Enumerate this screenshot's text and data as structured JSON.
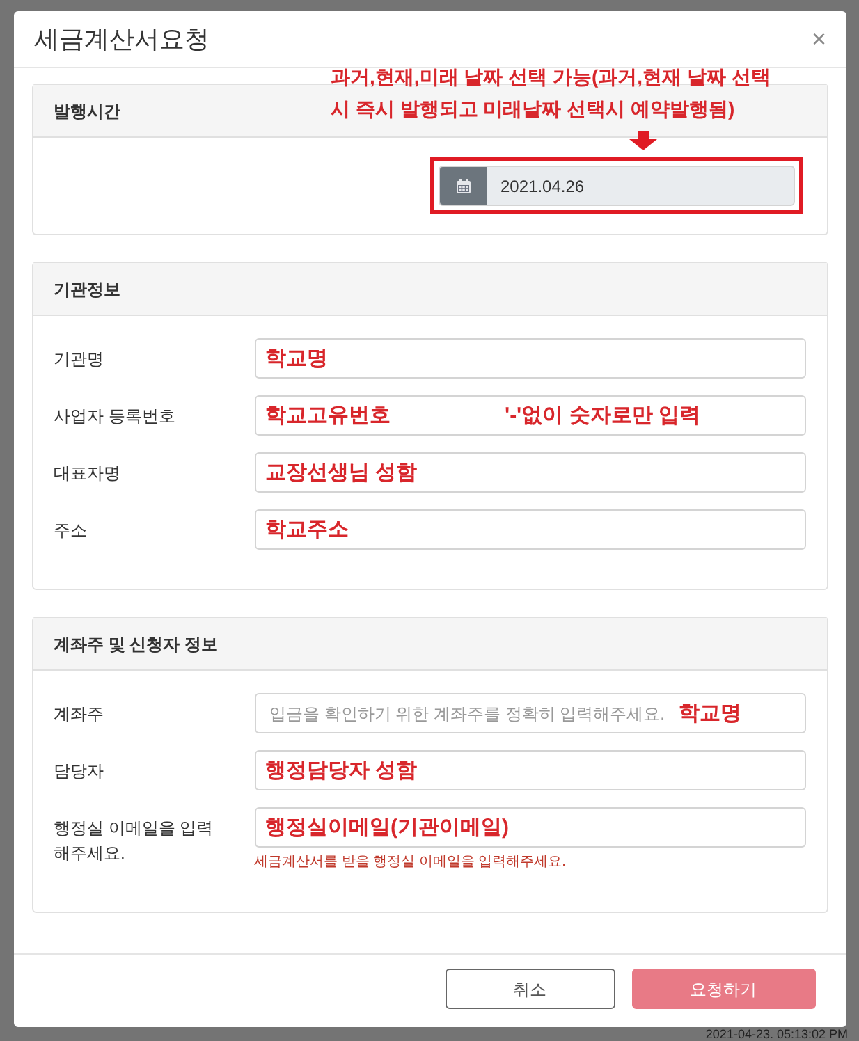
{
  "dialog": {
    "title": "세금계산서요청",
    "close": "×"
  },
  "annotation": {
    "lines": [
      "과거,현재,미래 날짜 선택 가능(과거,현재 날짜 선택",
      "시 즉시 발행되고 미래날짜 선택시 예약발행됨)"
    ]
  },
  "sections": [
    {
      "title": "발행시간",
      "kind": "date",
      "date": "2021.04.26"
    },
    {
      "title": "기관정보",
      "kind": "form",
      "fields": [
        {
          "label": "기관명",
          "annotation": "학교명"
        },
        {
          "label": "사업자 등록번호",
          "annotation": "학교고유번호",
          "note": "'-'없이 숫자로만 입력"
        },
        {
          "label": "대표자명",
          "annotation": "교장선생님 성함"
        },
        {
          "label": "주소",
          "annotation": "학교주소"
        }
      ]
    },
    {
      "title": "계좌주 및 신청자 정보",
      "kind": "form",
      "fields": [
        {
          "label": "계좌주",
          "placeholder": "입금을 확인하기 위한 계좌주를 정확히 입력해주세요.",
          "annotation": "학교명"
        },
        {
          "label": "담당자",
          "annotation": "행정담당자 성함"
        },
        {
          "label": "행정실 이메일을 입력 해주세요.",
          "annotation": "행정실이메일(기관이메일)",
          "help": "세금계산서를 받을 행정실 이메일을 입력해주세요."
        }
      ]
    }
  ],
  "buttons": [
    {
      "label": "취소",
      "kind": "secondary"
    },
    {
      "label": "요청하기",
      "kind": "primary"
    }
  ],
  "background": {
    "timestamp": "2021-04-23. 05:13:02 PM"
  }
}
